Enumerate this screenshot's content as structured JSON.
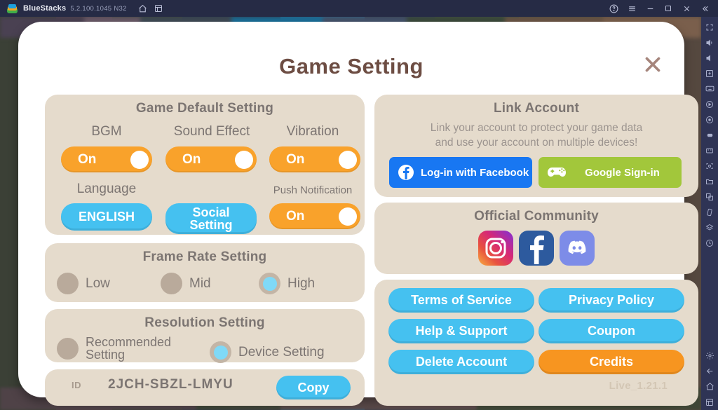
{
  "titlebar": {
    "app_name": "BlueStacks",
    "version": "5.2.100.1045 N32",
    "icons": [
      "bluestacks-logo-icon",
      "home-icon",
      "multi-instance-icon"
    ],
    "right_icons": [
      "help-icon",
      "menu-icon",
      "minimize-icon",
      "maximize-icon",
      "close-icon",
      "collapse-icon"
    ]
  },
  "sidebar": {
    "icons": [
      "fullscreen-icon",
      "volume-up-icon",
      "volume-down-icon",
      "install-apk-icon",
      "keymapping-icon",
      "record-icon",
      "macro-icon",
      "gamepad-icon",
      "eco-mode-icon",
      "screenshot-icon",
      "media-manager-icon",
      "multi-instance-icon",
      "shake-icon",
      "layers-icon",
      "rotate-icon",
      "settings-gear-icon",
      "back-arrow-icon",
      "home-icon",
      "recents-icon"
    ]
  },
  "dialog": {
    "title": "Game Setting",
    "close_icon": "close-icon",
    "version_label": "Live_1.21.1"
  },
  "game_default": {
    "title": "Game Default Setting",
    "bgm": {
      "label": "BGM",
      "value": "On"
    },
    "sound_effect": {
      "label": "Sound Effect",
      "value": "On"
    },
    "vibration": {
      "label": "Vibration",
      "value": "On"
    },
    "language": {
      "label": "Language",
      "value": "ENGLISH"
    },
    "social": {
      "line1": "Social",
      "line2": "Setting"
    },
    "push_notification": {
      "label": "Push Notification",
      "value": "On"
    }
  },
  "frame_rate": {
    "title": "Frame Rate Setting",
    "options": [
      {
        "label": "Low",
        "selected": false
      },
      {
        "label": "Mid",
        "selected": false
      },
      {
        "label": "High",
        "selected": true
      }
    ]
  },
  "resolution": {
    "title": "Resolution Setting",
    "options": [
      {
        "line1": "Recommended",
        "line2": "Setting",
        "selected": false
      },
      {
        "line1": "Device Setting",
        "line2": "",
        "selected": true
      }
    ]
  },
  "account_id": {
    "label": "ID",
    "value": "2JCH-SBZL-LMYU",
    "copy_label": "Copy"
  },
  "link_account": {
    "title": "Link Account",
    "description_line1": "Link your account to protect your game data",
    "description_line2": "and use your account on multiple devices!",
    "facebook_label": "Log-in with Facebook",
    "facebook_icon": "facebook-icon",
    "google_label": "Google Sign-in",
    "google_icon": "gamepad-icon"
  },
  "community": {
    "title": "Official Community",
    "items": [
      {
        "name": "instagram-icon"
      },
      {
        "name": "facebook-icon"
      },
      {
        "name": "discord-icon"
      }
    ]
  },
  "link_buttons": {
    "terms": "Terms of Service",
    "privacy": "Privacy Policy",
    "help": "Help & Support",
    "coupon": "Coupon",
    "delete": "Delete Account",
    "credits": "Credits"
  },
  "colors": {
    "accent_blue": "#45c1f0",
    "accent_orange": "#f79520",
    "toggle_orange": "#f9a22b",
    "panel_bg": "#e5dbcc",
    "dialog_bg": "#ffffff",
    "title_brown": "#6d4d43",
    "label_gray": "#7c7572",
    "facebook_blue": "#1877f2",
    "google_green": "#a2c73b"
  }
}
